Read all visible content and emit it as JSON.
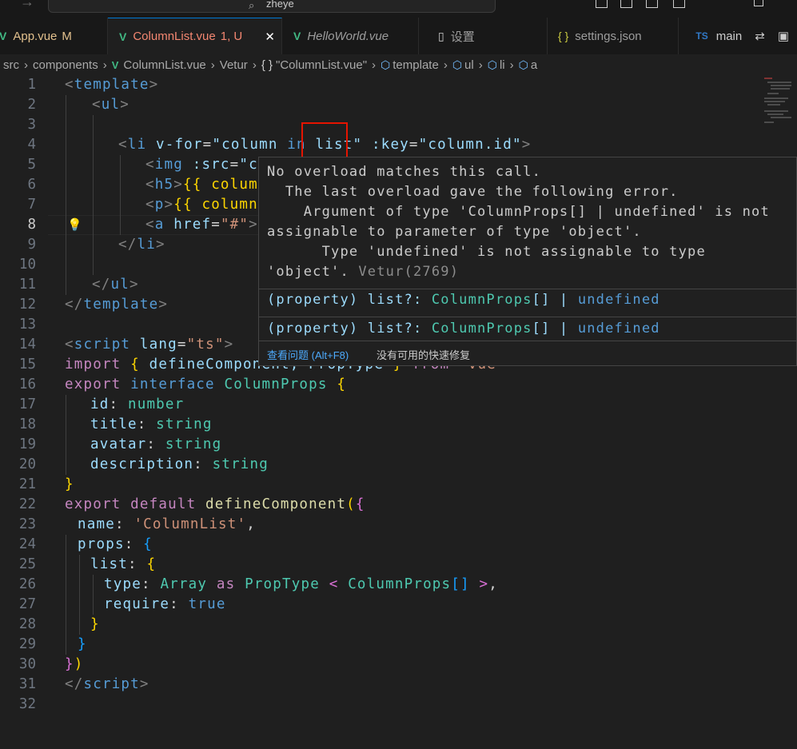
{
  "titlebar": {
    "search_text": "zheye"
  },
  "tabs": [
    {
      "label": "App.vue",
      "status": "M",
      "icon": "vue-icon"
    },
    {
      "label": "ColumnList.vue",
      "status": "1, U",
      "icon": "vue-icon",
      "active": true
    },
    {
      "label": "HelloWorld.vue",
      "status": "",
      "icon": "vue-icon"
    },
    {
      "label": "设置",
      "status": "",
      "icon": "file-icon"
    },
    {
      "label": "settings.json",
      "status": "",
      "icon": "braces-icon"
    }
  ],
  "tab_actions": {
    "branch_badge": "TS",
    "branch_label": "main"
  },
  "breadcrumb": [
    "src",
    "components",
    "ColumnList.vue",
    "Vetur",
    "\"ColumnList.vue\"",
    "template",
    "ul",
    "li",
    "a"
  ],
  "code": {
    "line_numbers": [
      "1",
      "2",
      "3",
      "4",
      "5",
      "6",
      "7",
      "8",
      "9",
      "10",
      "11",
      "12",
      "13",
      "14",
      "15",
      "16",
      "17",
      "18",
      "19",
      "20",
      "21",
      "22",
      "23",
      "24",
      "25",
      "26",
      "27",
      "28",
      "29",
      "30",
      "31",
      "32"
    ],
    "current_line": 8,
    "l1": [
      "<",
      "template",
      ">"
    ],
    "l2": [
      "<",
      "ul",
      ">"
    ],
    "l4": [
      "<",
      "li",
      " v-for",
      "=",
      "\"column ",
      "in",
      " ",
      "list",
      "\"",
      " :key",
      "=",
      "\"column.id\"",
      ">"
    ],
    "l5": [
      "<",
      "img",
      " :src",
      "=",
      "\"c"
    ],
    "l6": [
      "<",
      "h5",
      ">",
      "{{ colum"
    ],
    "l7": [
      "<",
      "p",
      ">",
      "{{ column"
    ],
    "l8": [
      "<",
      "a",
      " href",
      "=",
      "\"#\"",
      ">"
    ],
    "l9": [
      "</",
      "li",
      ">"
    ],
    "l11": [
      "</",
      "ul",
      ">"
    ],
    "l12": [
      "</",
      "template",
      ">"
    ],
    "l14": [
      "<",
      "script",
      " lang",
      "=",
      "\"ts\"",
      ">"
    ],
    "l15": [
      "import",
      " ",
      "{",
      " defineComponent, PropType ",
      "}",
      " from ",
      "'vue'"
    ],
    "l16": [
      "export",
      " interface ",
      "ColumnProps",
      " ",
      "{"
    ],
    "l17": [
      "id",
      ": ",
      "number"
    ],
    "l18": [
      "title",
      ": ",
      "string"
    ],
    "l19": [
      "avatar",
      ": ",
      "string"
    ],
    "l20": [
      "description",
      ": ",
      "string"
    ],
    "l21": [
      "}"
    ],
    "l22": [
      "export",
      " default ",
      "defineComponent",
      "(",
      "{"
    ],
    "l23": [
      "name",
      ": ",
      "'ColumnList'",
      ","
    ],
    "l24": [
      "props",
      ": ",
      "{"
    ],
    "l25": [
      "list",
      ": ",
      "{"
    ],
    "l26": [
      "type",
      ": ",
      "Array",
      " as ",
      "PropType",
      " < ",
      "ColumnProps",
      "[]",
      " >",
      ","
    ],
    "l27": [
      "require",
      ": ",
      "true"
    ],
    "l28": [
      "}"
    ],
    "l29": [
      "}"
    ],
    "l30": [
      "}",
      ")"
    ],
    "l31": [
      "</",
      "script",
      ">"
    ]
  },
  "hover": {
    "message_lines": [
      "No overload matches this call.",
      "  The last overload gave the following error.",
      "    Argument of type 'ColumnProps[] | undefined' is not",
      "assignable to parameter of type 'object'.",
      "      Type 'undefined' is not assignable to type",
      "'object'."
    ],
    "source": "Vetur(2769)",
    "signature": [
      "(property) list?: ",
      "ColumnProps",
      "[] | ",
      "undefined"
    ],
    "view_problem": "查看问题 (Alt+F8)",
    "no_fix": "没有可用的快速修复"
  }
}
